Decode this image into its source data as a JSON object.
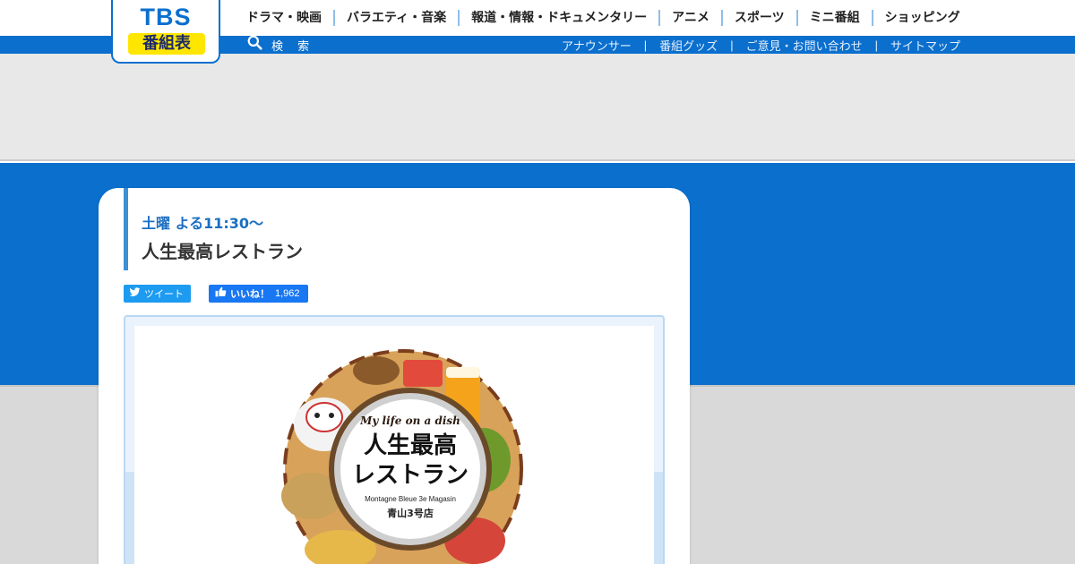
{
  "brand": {
    "logo_main": "TBS",
    "logo_sub": "番組表",
    "primary_color": "#0b6fce",
    "logo_sub_color": "#ffe600"
  },
  "nav": {
    "items": [
      {
        "label": "ドラマ・映画"
      },
      {
        "label": "バラエティ・音楽"
      },
      {
        "label": "報道・情報・ドキュメンタリー"
      },
      {
        "label": "アニメ"
      },
      {
        "label": "スポーツ"
      },
      {
        "label": "ミニ番組"
      },
      {
        "label": "ショッピング"
      }
    ]
  },
  "search": {
    "icon": "search-icon",
    "label": "検 索"
  },
  "subnav": {
    "items": [
      {
        "label": "アナウンサー"
      },
      {
        "label": "番組グッズ"
      },
      {
        "label": "ご意見・お問い合わせ"
      },
      {
        "label": "サイトマップ"
      }
    ],
    "separator": "|"
  },
  "program": {
    "schedule": "土曜 よる11:30〜",
    "title": "人生最高レストラン"
  },
  "social": {
    "tweet": {
      "icon": "twitter-bird-icon",
      "label": "ツイート"
    },
    "like": {
      "icon": "thumbs-up-icon",
      "label": "いいね！",
      "count": "1,962"
    }
  },
  "hero_image": {
    "tagline": "My life on a dish",
    "title_line1": "人生最高",
    "title_line2": "レストラン",
    "subtitle": "Montagne Bleue 3e Magasin",
    "store": "青山3号店"
  }
}
